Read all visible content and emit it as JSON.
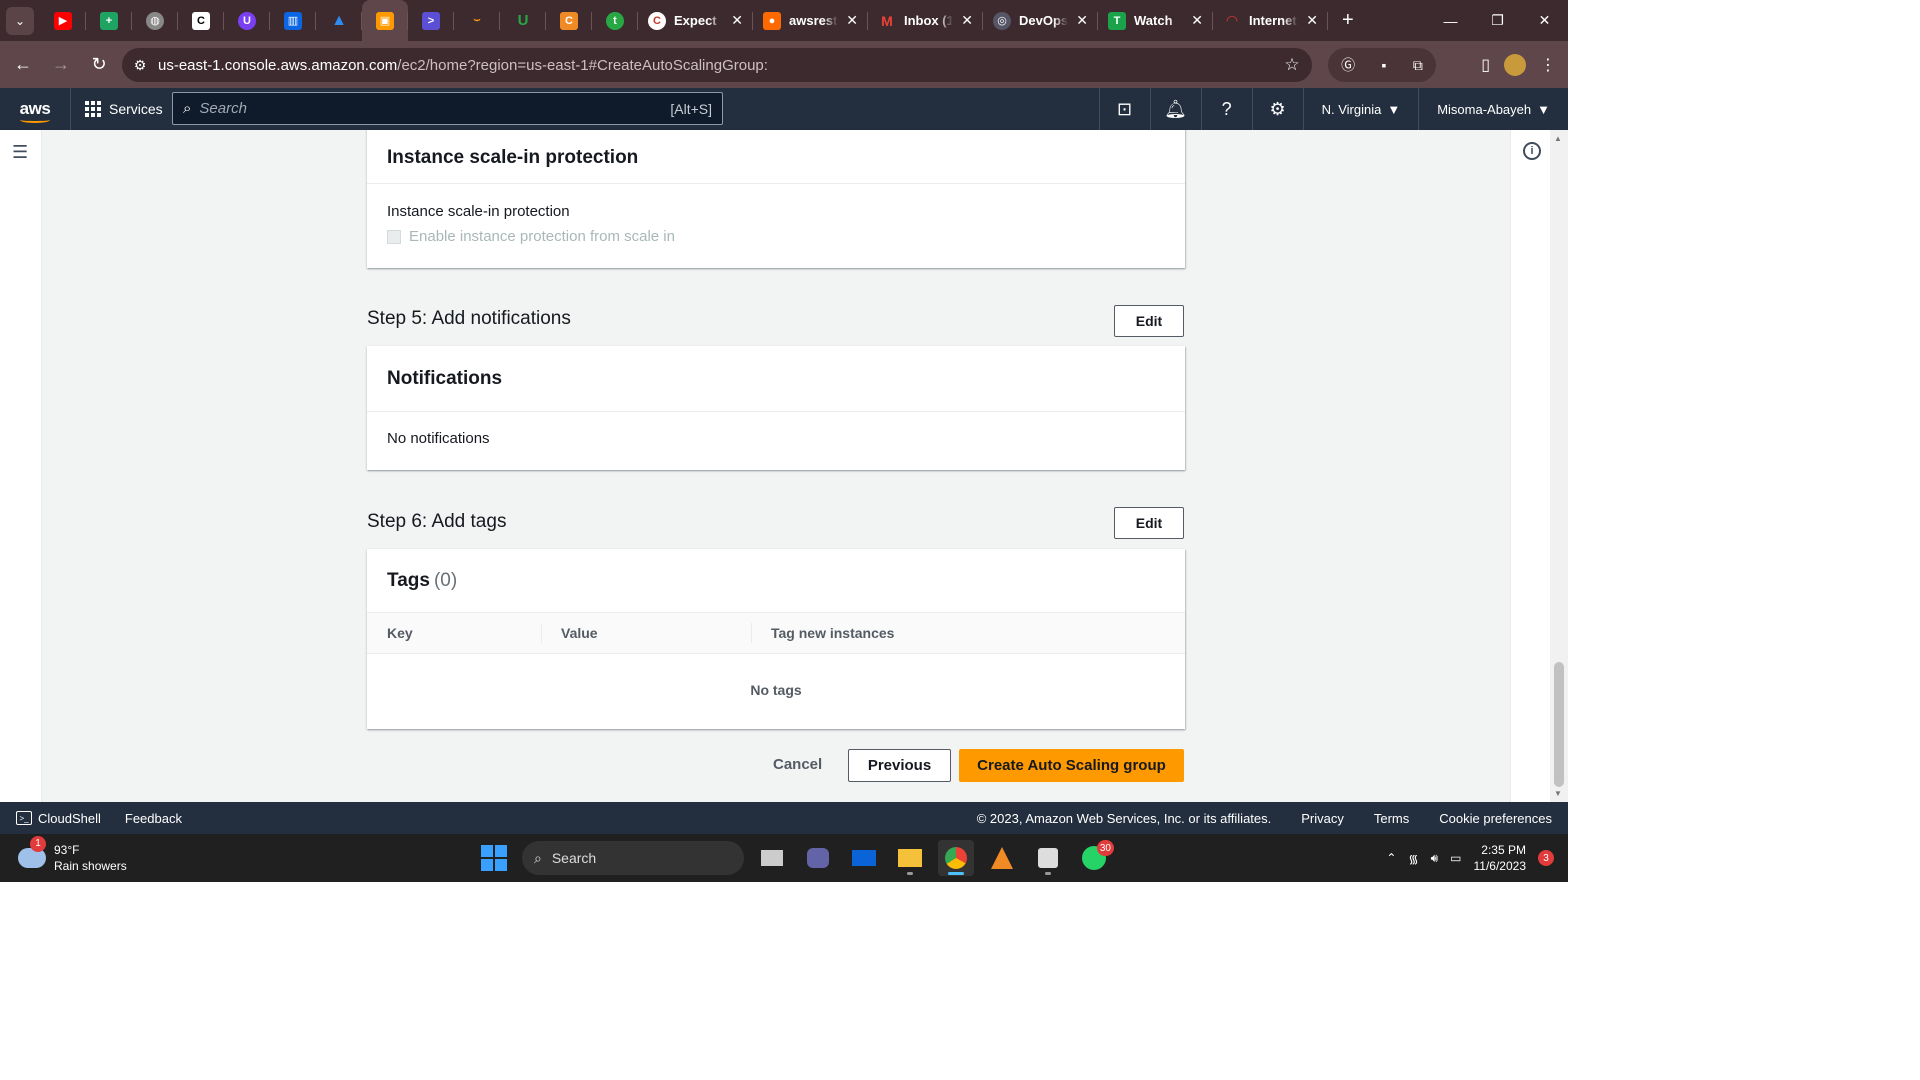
{
  "browser": {
    "tabs": [
      {
        "title": "Expect",
        "icon": "expect-favicon"
      },
      {
        "title": "awsrest",
        "icon": "awsrest-favicon"
      },
      {
        "title": "Inbox (1",
        "icon": "gmail-favicon"
      },
      {
        "title": "DevOps",
        "icon": "devops-favicon"
      },
      {
        "title": "Watch",
        "icon": "watch-favicon"
      },
      {
        "title": "Internet",
        "icon": "internet-favicon"
      }
    ],
    "url_host": "us-east-1.console.aws.amazon.com",
    "url_path": "/ec2/home?region=us-east-1#CreateAutoScalingGroup:"
  },
  "aws_header": {
    "logo": "aws",
    "services_label": "Services",
    "search_placeholder": "Search",
    "search_shortcut": "[Alt+S]",
    "region": "N. Virginia",
    "account": "Misoma-Abayeh"
  },
  "scale_in": {
    "title": "Instance scale-in protection",
    "field_label": "Instance scale-in protection",
    "checkbox_label": "Enable instance protection from scale in"
  },
  "step5": {
    "title": "Step 5: Add notifications",
    "edit_label": "Edit",
    "card_title": "Notifications",
    "empty_text": "No notifications"
  },
  "step6": {
    "title": "Step 6: Add tags",
    "edit_label": "Edit",
    "card_title": "Tags",
    "count": "(0)",
    "columns": [
      "Key",
      "Value",
      "Tag new instances"
    ],
    "empty_text": "No tags"
  },
  "actions": {
    "cancel": "Cancel",
    "previous": "Previous",
    "create": "Create Auto Scaling group"
  },
  "aws_footer": {
    "cloudshell": "CloudShell",
    "feedback": "Feedback",
    "copyright": "© 2023, Amazon Web Services, Inc. or its affiliates.",
    "privacy": "Privacy",
    "terms": "Terms",
    "cookies": "Cookie preferences"
  },
  "taskbar": {
    "weather_temp": "93°F",
    "weather_desc": "Rain showers",
    "weather_badge": "1",
    "search_label": "Search",
    "whatsapp_badge": "30",
    "time": "2:35 PM",
    "date": "11/6/2023",
    "notif_count": "3"
  },
  "colors": {
    "primary_button": "#ff9900",
    "aws_nav": "#232f3e",
    "browser_frame": "#3c2a2e"
  }
}
